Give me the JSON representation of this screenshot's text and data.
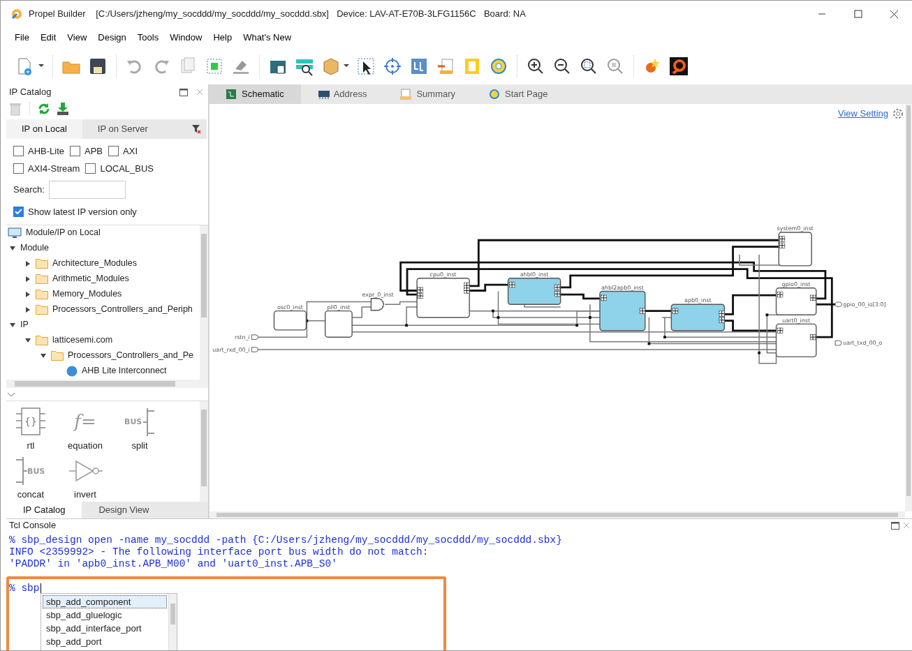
{
  "window": {
    "title": "Propel Builder",
    "path": "[C:/Users/jzheng/my_socddd/my_socddd/my_socddd.sbx]",
    "device": "Device: LAV-AT-E70B-3LFG1156C",
    "board": "Board: NA"
  },
  "menu": [
    "File",
    "Edit",
    "View",
    "Design",
    "Tools",
    "Window",
    "Help",
    "What's New"
  ],
  "ip_catalog": {
    "title": "IP Catalog",
    "tabs": [
      {
        "label": "IP on Local",
        "selected": true
      },
      {
        "label": "IP on Server",
        "selected": false
      }
    ],
    "filters": [
      {
        "label": "AHB-Lite",
        "checked": false
      },
      {
        "label": "APB",
        "checked": false
      },
      {
        "label": "AXI",
        "checked": false
      },
      {
        "label": "AXI4-Stream",
        "checked": false
      },
      {
        "label": "LOCAL_BUS",
        "checked": false
      }
    ],
    "search": {
      "label": "Search:"
    },
    "latest_only": {
      "label": "Show latest IP version only",
      "checked": true
    },
    "tree_title": "Module/IP on Local",
    "tree": [
      {
        "label": "Module",
        "expanded": true,
        "children": [
          {
            "label": "Architecture_Modules",
            "kind": "folder",
            "expanded": false
          },
          {
            "label": "Arithmetic_Modules",
            "kind": "folder",
            "expanded": false
          },
          {
            "label": "Memory_Modules",
            "kind": "folder",
            "expanded": false
          },
          {
            "label": "Processors_Controllers_and_Periph",
            "kind": "folder",
            "expanded": false
          }
        ]
      },
      {
        "label": "IP",
        "expanded": true,
        "children": [
          {
            "label": "latticesemi.com",
            "kind": "folder",
            "expanded": true,
            "children": [
              {
                "label": "Processors_Controllers_and_Pe",
                "kind": "folder",
                "expanded": true,
                "children": [
                  {
                    "label": "AHB Lite Interconnect",
                    "kind": "ip"
                  }
                ]
              }
            ]
          }
        ]
      }
    ],
    "palette": [
      {
        "label": "rtl",
        "kind": "rtl",
        "symbol": "{}"
      },
      {
        "label": "equation",
        "kind": "equation",
        "symbol": "f="
      },
      {
        "label": "split",
        "kind": "split",
        "symbol": "BUS"
      },
      {
        "label": "concat",
        "kind": "concat",
        "symbol": "BUS"
      },
      {
        "label": "invert",
        "kind": "invert"
      }
    ],
    "bottom_tabs": [
      {
        "label": "IP Catalog",
        "selected": true
      },
      {
        "label": "Design View",
        "selected": false
      }
    ]
  },
  "editor": {
    "tabs": [
      {
        "label": "Schematic",
        "selected": true
      },
      {
        "label": "Address",
        "selected": false
      },
      {
        "label": "Summary",
        "selected": false
      },
      {
        "label": "Start Page",
        "selected": false
      }
    ],
    "view_setting": "View Setting",
    "schematic": {
      "instances": [
        {
          "label": "system0_inst",
          "kind": "block",
          "highlighted": false
        },
        {
          "label": "cpu0_inst",
          "kind": "block",
          "highlighted": false
        },
        {
          "label": "ahbl0_inst",
          "kind": "block",
          "highlighted": true
        },
        {
          "label": "ahbl2apb0_inst",
          "kind": "block",
          "highlighted": true
        },
        {
          "label": "apb0_inst",
          "kind": "block",
          "highlighted": true
        },
        {
          "label": "gpio0_inst",
          "kind": "block",
          "highlighted": false
        },
        {
          "label": "uart0_inst",
          "kind": "block",
          "highlighted": false
        },
        {
          "label": "osc0_inst",
          "kind": "block",
          "highlighted": false
        },
        {
          "label": "pll0_inst",
          "kind": "block",
          "highlighted": false
        },
        {
          "label": "expr_0_inst",
          "kind": "and_gate",
          "highlighted": false
        }
      ],
      "ports": [
        {
          "label": "rstn_i",
          "kind": "input"
        },
        {
          "label": "uart_rxd_00_i",
          "kind": "input"
        },
        {
          "label": "gpio_00_io[3:0]",
          "kind": "inout"
        },
        {
          "label": "uart_txd_00_o",
          "kind": "output"
        }
      ]
    }
  },
  "console": {
    "title": "Tcl Console",
    "lines": [
      "% sbp_design open -name my_socddd -path {C:/Users/jzheng/my_socddd/my_socddd/my_socddd.sbx}",
      "INFO <2359992> - The following interface port bus width do not match:",
      "'PADDR' in 'apb0_inst.APB_M00' and 'uart0_inst.APB_S0'"
    ],
    "prompt": "% sbp",
    "completions": [
      {
        "label": "sbp_add_component",
        "selected": true
      },
      {
        "label": "sbp_add_gluelogic",
        "selected": false
      },
      {
        "label": "sbp_add_interface_port",
        "selected": false
      },
      {
        "label": "sbp_add_port",
        "selected": false
      }
    ]
  }
}
